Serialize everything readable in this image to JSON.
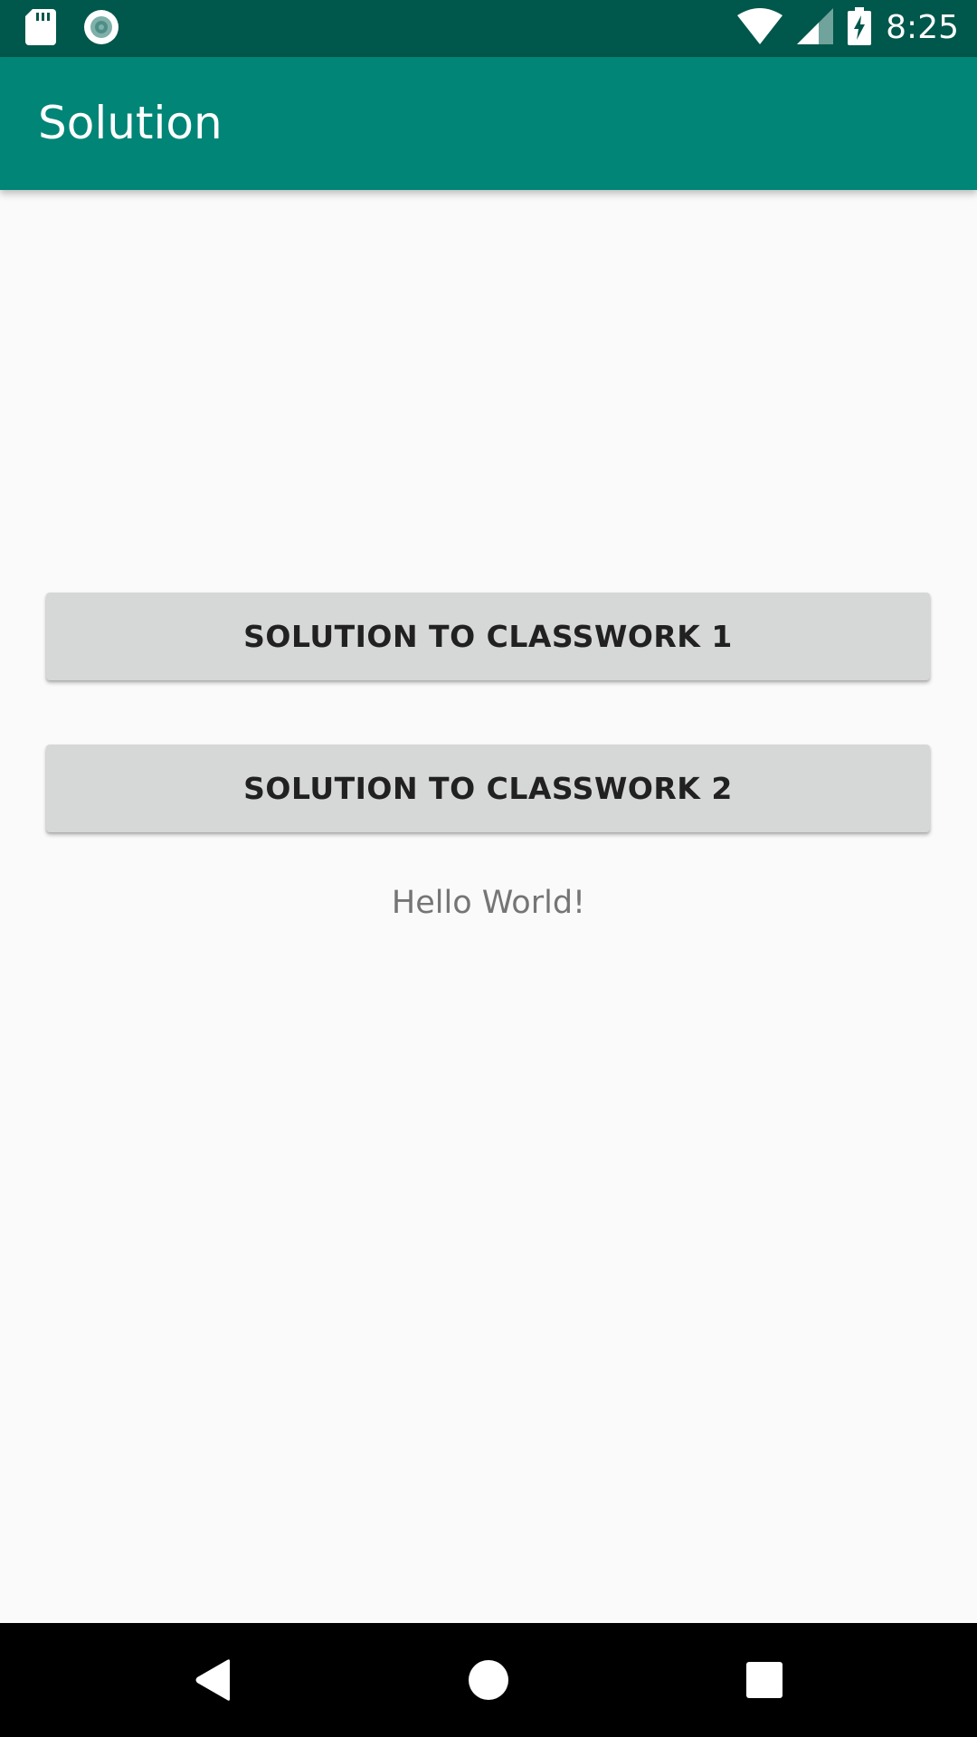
{
  "status_bar": {
    "time": "8:25",
    "icons": [
      "sd-card-icon",
      "sync-icon",
      "wifi-icon",
      "cell-signal-icon",
      "battery-charging-icon"
    ]
  },
  "app_bar": {
    "title": "Solution"
  },
  "main": {
    "button_1_label": "Solution to Classwork 1",
    "button_2_label": "Solution to Classwork 2",
    "hello_text": "Hello World!"
  },
  "nav_bar": {
    "icons": [
      "back-icon",
      "home-icon",
      "recents-icon"
    ]
  },
  "colors": {
    "status_bar": "#00574b",
    "app_bar": "#008577",
    "background": "#fafafa",
    "button": "#d6d7d7"
  }
}
